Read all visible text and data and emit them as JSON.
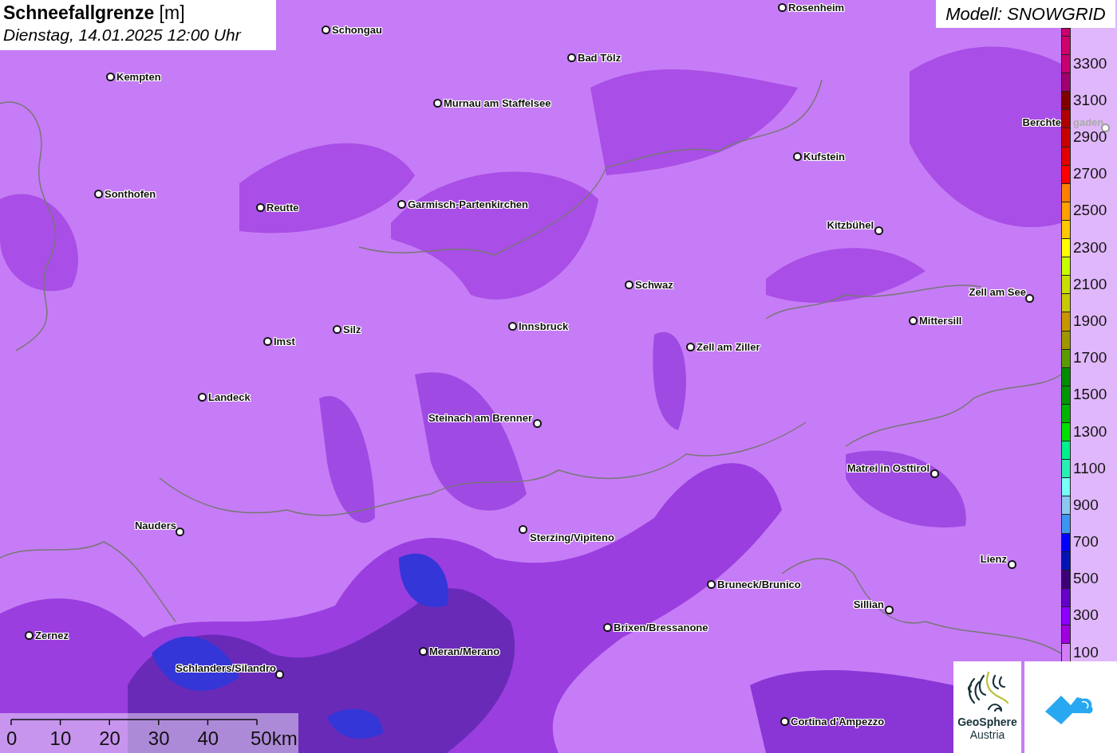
{
  "title": {
    "text": "**Schneefallgrenze** [m]",
    "subtitle": "Dienstag, 14.01.2025 12:00 Uhr"
  },
  "model": "Modell: SNOWGRID",
  "cities": [
    {
      "name": "Schongau"
    },
    {
      "name": "Rosenheim"
    },
    {
      "name": "Bad Tölz"
    },
    {
      "name": "Kempten"
    },
    {
      "name": "Murnau am Staffelsee"
    },
    {
      "name": "Kufstein"
    },
    {
      "name": "Sonthofen"
    },
    {
      "name": "Reutte"
    },
    {
      "name": "Garmisch-Partenkirchen"
    },
    {
      "name": "Kitzbühel"
    },
    {
      "name": "Schwaz"
    },
    {
      "name": "Zell am See"
    },
    {
      "name": "Mittersill"
    },
    {
      "name": "Innsbruck"
    },
    {
      "name": "Silz"
    },
    {
      "name": "Imst"
    },
    {
      "name": "Zell am Ziller"
    },
    {
      "name": "Landeck"
    },
    {
      "name": "Steinach am Brenner"
    },
    {
      "name": "Matrei in Osttirol"
    },
    {
      "name": "Nauders"
    },
    {
      "name": "Sterzing/Vipiteno"
    },
    {
      "name": "Lienz"
    },
    {
      "name": "Bruneck/Brunico"
    },
    {
      "name": "Sillian"
    },
    {
      "name": "Brixen/Bressanone"
    },
    {
      "name": "Zernez"
    },
    {
      "name": "Meran/Merano"
    },
    {
      "name": "Schlanders/Silandro"
    },
    {
      "name": "Cortina d'Ampezzo"
    },
    {
      "name": "Berchte",
      "name_tail": "gaden"
    }
  ],
  "legend": [
    {
      "color": "#c8006e"
    },
    {
      "color": "#d0006a"
    },
    {
      "color": "#c80070",
      "label": "3300"
    },
    {
      "color": "#a00070"
    },
    {
      "color": "#800000",
      "label": "3100"
    },
    {
      "color": "#b00000"
    },
    {
      "color": "#c80000",
      "label": "2900"
    },
    {
      "color": "#e00000"
    },
    {
      "color": "#ff0000",
      "label": "2700"
    },
    {
      "color": "#ff8000"
    },
    {
      "color": "#ffa000",
      "label": "2500"
    },
    {
      "color": "#ffc800"
    },
    {
      "color": "#ffff00",
      "label": "2300"
    },
    {
      "color": "#c8ff00"
    },
    {
      "color": "#c8e000",
      "label": "2100"
    },
    {
      "color": "#c8c800"
    },
    {
      "color": "#c89600",
      "label": "1900"
    },
    {
      "color": "#a09600"
    },
    {
      "color": "#5a9c00",
      "label": "1700"
    },
    {
      "color": "#008c00"
    },
    {
      "color": "#009600",
      "label": "1500"
    },
    {
      "color": "#00b400"
    },
    {
      "color": "#00e000",
      "label": "1300"
    },
    {
      "color": "#00f08c"
    },
    {
      "color": "#28f0b4",
      "label": "1100"
    },
    {
      "color": "#78fff8"
    },
    {
      "color": "#8cc8f0",
      "label": "900"
    },
    {
      "color": "#3c96f0"
    },
    {
      "color": "#0000ff",
      "label": "700"
    },
    {
      "color": "#0014b4"
    },
    {
      "color": "#3c0078",
      "label": "500"
    },
    {
      "color": "#6400c8"
    },
    {
      "color": "#8c00ff",
      "label": "300"
    },
    {
      "color": "#a000e0"
    },
    {
      "color": "#d27cf8",
      "label": "100"
    }
  ],
  "scale": {
    "ticks": [
      "0",
      "10",
      "20",
      "30",
      "40",
      "50km"
    ]
  },
  "logos": [
    {
      "kind": "geosphere",
      "lines": [
        "GeoSphere",
        "Austria"
      ]
    },
    {
      "kind": "mountain"
    }
  ]
}
